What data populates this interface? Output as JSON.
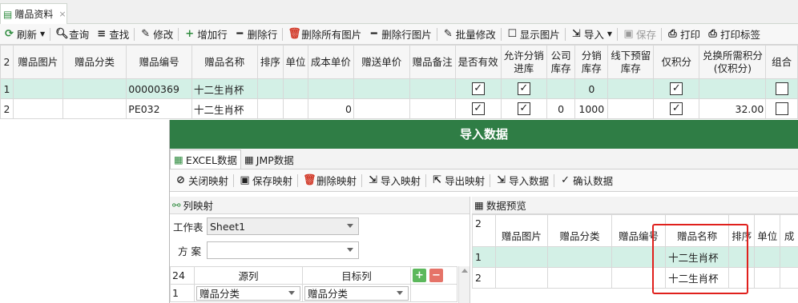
{
  "tab": {
    "title": "赠品资料",
    "close": "×"
  },
  "toolbar": [
    {
      "name": "refresh",
      "label": "刷新",
      "icon": "⟳",
      "cls": "g",
      "dropdown": true
    },
    {
      "name": "query",
      "label": "查询",
      "icon": "🔍︎",
      "cls": "d"
    },
    {
      "name": "find",
      "label": "查找",
      "icon": "≡",
      "cls": "d"
    },
    {
      "name": "edit",
      "label": "修改",
      "icon": "✎",
      "cls": "d"
    },
    {
      "name": "add-row",
      "label": "增加行",
      "icon": "+",
      "cls": "g"
    },
    {
      "name": "delete-row",
      "label": "删除行",
      "icon": "━",
      "cls": "d"
    },
    {
      "name": "delete-all-images",
      "label": "删除所有图片",
      "icon": "🗑︎",
      "cls": "r"
    },
    {
      "name": "delete-row-image",
      "label": "删除行图片",
      "icon": "━",
      "cls": "d"
    },
    {
      "name": "batch-edit",
      "label": "批量修改",
      "icon": "✎",
      "cls": "d"
    },
    {
      "name": "show-images",
      "label": "显示图片",
      "icon": "☐",
      "cls": "d"
    },
    {
      "name": "import",
      "label": "导入",
      "icon": "⇲",
      "cls": "d",
      "dropdown": true
    },
    {
      "name": "save",
      "label": "保存",
      "icon": "▣",
      "cls": "gray"
    },
    {
      "name": "print",
      "label": "打印",
      "icon": "⎙",
      "cls": "d"
    },
    {
      "name": "print-label",
      "label": "打印标签",
      "icon": "⎙",
      "cls": "d"
    }
  ],
  "grid": {
    "corner": "2",
    "columns": [
      "赠品图片",
      "赠品分类",
      "赠品编号",
      "赠品名称",
      "排序",
      "单位",
      "成本单价",
      "赠送单价",
      "赠品备注",
      "是否有效",
      "允许分销进库",
      "公司库存",
      "分销库存",
      "线下预留库存",
      "仅积分",
      "兑换所需积分(仅积分)",
      "组合"
    ],
    "rows": [
      {
        "idx": "1",
        "code": "00000369",
        "name": "十二生肖杯",
        "cost": "",
        "valid": true,
        "allow": true,
        "company_stock": "",
        "dist_stock": "0",
        "only_points": true,
        "points": ""
      },
      {
        "idx": "2",
        "code": "PE032",
        "name": "十二生肖杯",
        "cost": "0",
        "valid": true,
        "allow": true,
        "company_stock": "0",
        "dist_stock": "1000",
        "only_points": true,
        "points": "32.00"
      }
    ]
  },
  "dialog": {
    "title": "导入数据",
    "tabs": [
      "EXCEL数据",
      "JMP数据"
    ],
    "tools": [
      {
        "name": "close-mapping",
        "label": "关闭映射",
        "icon": "⊘"
      },
      {
        "name": "save-mapping",
        "label": "保存映射",
        "icon": "▣"
      },
      {
        "name": "delete-mapping",
        "label": "删除映射",
        "icon": "🗑︎"
      },
      {
        "name": "import-mapping",
        "label": "导入映射",
        "icon": "⇲"
      },
      {
        "name": "export-mapping",
        "label": "导出映射",
        "icon": "⇱"
      },
      {
        "name": "import-data",
        "label": "导入数据",
        "icon": "⇲"
      },
      {
        "name": "confirm-data",
        "label": "确认数据",
        "icon": "✓"
      }
    ],
    "mapping": {
      "title": "列映射",
      "sheet_label": "工作表",
      "sheet_value": "Sheet1",
      "plan_label": "方 案",
      "plan_value": "",
      "count": "24",
      "source_header": "源列",
      "target_header": "目标列",
      "rows": [
        {
          "idx": "1",
          "source": "赠品分类",
          "target": "赠品分类"
        }
      ]
    },
    "preview": {
      "title": "数据预览",
      "corner": "2",
      "columns": [
        "赠品图片",
        "赠品分类",
        "赠品编号",
        "赠品名称",
        "排序",
        "单位",
        "成"
      ],
      "rows": [
        {
          "idx": "1",
          "name": "十二生肖杯"
        },
        {
          "idx": "2",
          "name": "十二生肖杯"
        }
      ]
    }
  }
}
